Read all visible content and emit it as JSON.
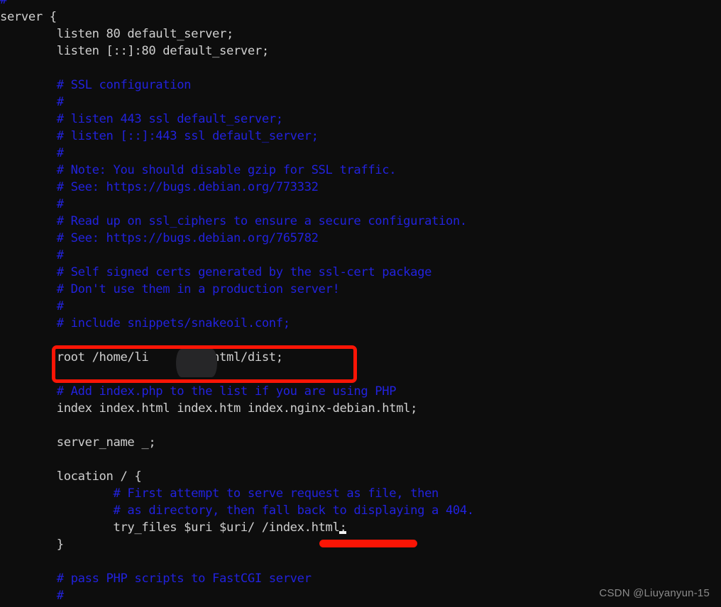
{
  "window": {
    "background_color": "#0d0d0d",
    "text_color": "#cfcfcf",
    "comment_color": "#2222dd",
    "annotation_color": "#fb1505",
    "file_type": "nginx-config"
  },
  "code": {
    "lines": [
      {
        "indent": "",
        "segments": [
          {
            "kind": "comment",
            "text": "#"
          }
        ]
      },
      {
        "indent": "",
        "segments": [
          {
            "kind": "text",
            "text": "server {"
          }
        ]
      },
      {
        "indent": "        ",
        "segments": [
          {
            "kind": "text",
            "text": "listen 80 default_server;"
          }
        ]
      },
      {
        "indent": "        ",
        "segments": [
          {
            "kind": "text",
            "text": "listen [::]:80 default_server;"
          }
        ]
      },
      {
        "indent": "",
        "segments": []
      },
      {
        "indent": "        ",
        "segments": [
          {
            "kind": "comment",
            "text": "# SSL configuration"
          }
        ]
      },
      {
        "indent": "        ",
        "segments": [
          {
            "kind": "comment",
            "text": "#"
          }
        ]
      },
      {
        "indent": "        ",
        "segments": [
          {
            "kind": "comment",
            "text": "# listen 443 ssl default_server;"
          }
        ]
      },
      {
        "indent": "        ",
        "segments": [
          {
            "kind": "comment",
            "text": "# listen [::]:443 ssl default_server;"
          }
        ]
      },
      {
        "indent": "        ",
        "segments": [
          {
            "kind": "comment",
            "text": "#"
          }
        ]
      },
      {
        "indent": "        ",
        "segments": [
          {
            "kind": "comment",
            "text": "# Note: You should disable gzip for SSL traffic."
          }
        ]
      },
      {
        "indent": "        ",
        "segments": [
          {
            "kind": "comment",
            "text": "# See: https://bugs.debian.org/773332"
          }
        ]
      },
      {
        "indent": "        ",
        "segments": [
          {
            "kind": "comment",
            "text": "#"
          }
        ]
      },
      {
        "indent": "        ",
        "segments": [
          {
            "kind": "comment",
            "text": "# Read up on ssl_ciphers to ensure a secure configuration."
          }
        ]
      },
      {
        "indent": "        ",
        "segments": [
          {
            "kind": "comment",
            "text": "# See: https://bugs.debian.org/765782"
          }
        ]
      },
      {
        "indent": "        ",
        "segments": [
          {
            "kind": "comment",
            "text": "#"
          }
        ]
      },
      {
        "indent": "        ",
        "segments": [
          {
            "kind": "comment",
            "text": "# Self signed certs generated by the ssl-cert package"
          }
        ]
      },
      {
        "indent": "        ",
        "segments": [
          {
            "kind": "comment",
            "text": "# Don't use them in a production server!"
          }
        ]
      },
      {
        "indent": "        ",
        "segments": [
          {
            "kind": "comment",
            "text": "#"
          }
        ]
      },
      {
        "indent": "        ",
        "segments": [
          {
            "kind": "comment",
            "text": "# include snippets/snakeoil.conf;"
          }
        ]
      },
      {
        "indent": "",
        "segments": []
      },
      {
        "indent": "        ",
        "segments": [
          {
            "kind": "text",
            "text": "root /home/li      un/html/dist;"
          }
        ]
      },
      {
        "indent": "",
        "segments": []
      },
      {
        "indent": "        ",
        "segments": [
          {
            "kind": "comment",
            "text": "# Add index.php to the list if you are using PHP"
          }
        ]
      },
      {
        "indent": "        ",
        "segments": [
          {
            "kind": "text",
            "text": "index index.html index.htm index.nginx-debian.html;"
          }
        ]
      },
      {
        "indent": "",
        "segments": []
      },
      {
        "indent": "        ",
        "segments": [
          {
            "kind": "text",
            "text": "server_name _;"
          }
        ]
      },
      {
        "indent": "",
        "segments": []
      },
      {
        "indent": "        ",
        "segments": [
          {
            "kind": "text",
            "text": "location / {"
          }
        ]
      },
      {
        "indent": "                ",
        "segments": [
          {
            "kind": "comment",
            "text": "# First attempt to serve request as file, then"
          }
        ]
      },
      {
        "indent": "                ",
        "segments": [
          {
            "kind": "comment",
            "text": "# as directory, then fall back to displaying a 404."
          }
        ]
      },
      {
        "indent": "                ",
        "segments": [
          {
            "kind": "text",
            "text": "try_files $uri $uri/ /index.html"
          },
          {
            "kind": "cursor",
            "text": ""
          },
          {
            "kind": "text",
            "text": ";"
          }
        ]
      },
      {
        "indent": "        ",
        "segments": [
          {
            "kind": "text",
            "text": "}"
          }
        ]
      },
      {
        "indent": "",
        "segments": []
      },
      {
        "indent": "        ",
        "segments": [
          {
            "kind": "comment",
            "text": "# pass PHP scripts to FastCGI server"
          }
        ]
      },
      {
        "indent": "        ",
        "segments": [
          {
            "kind": "comment",
            "text": "#"
          }
        ]
      }
    ]
  },
  "annotations": {
    "root_box": {
      "label": "root-directive-highlight",
      "content": "root /home/li      un/html/dist;",
      "color": "#fb1505"
    },
    "redaction": {
      "label": "redacted-username",
      "color": "#262628"
    },
    "index_underline": {
      "label": "index-html-underline",
      "content": "/index.html",
      "color": "#fb1505"
    }
  },
  "watermark": {
    "text": "CSDN @Liuyanyun-15"
  }
}
